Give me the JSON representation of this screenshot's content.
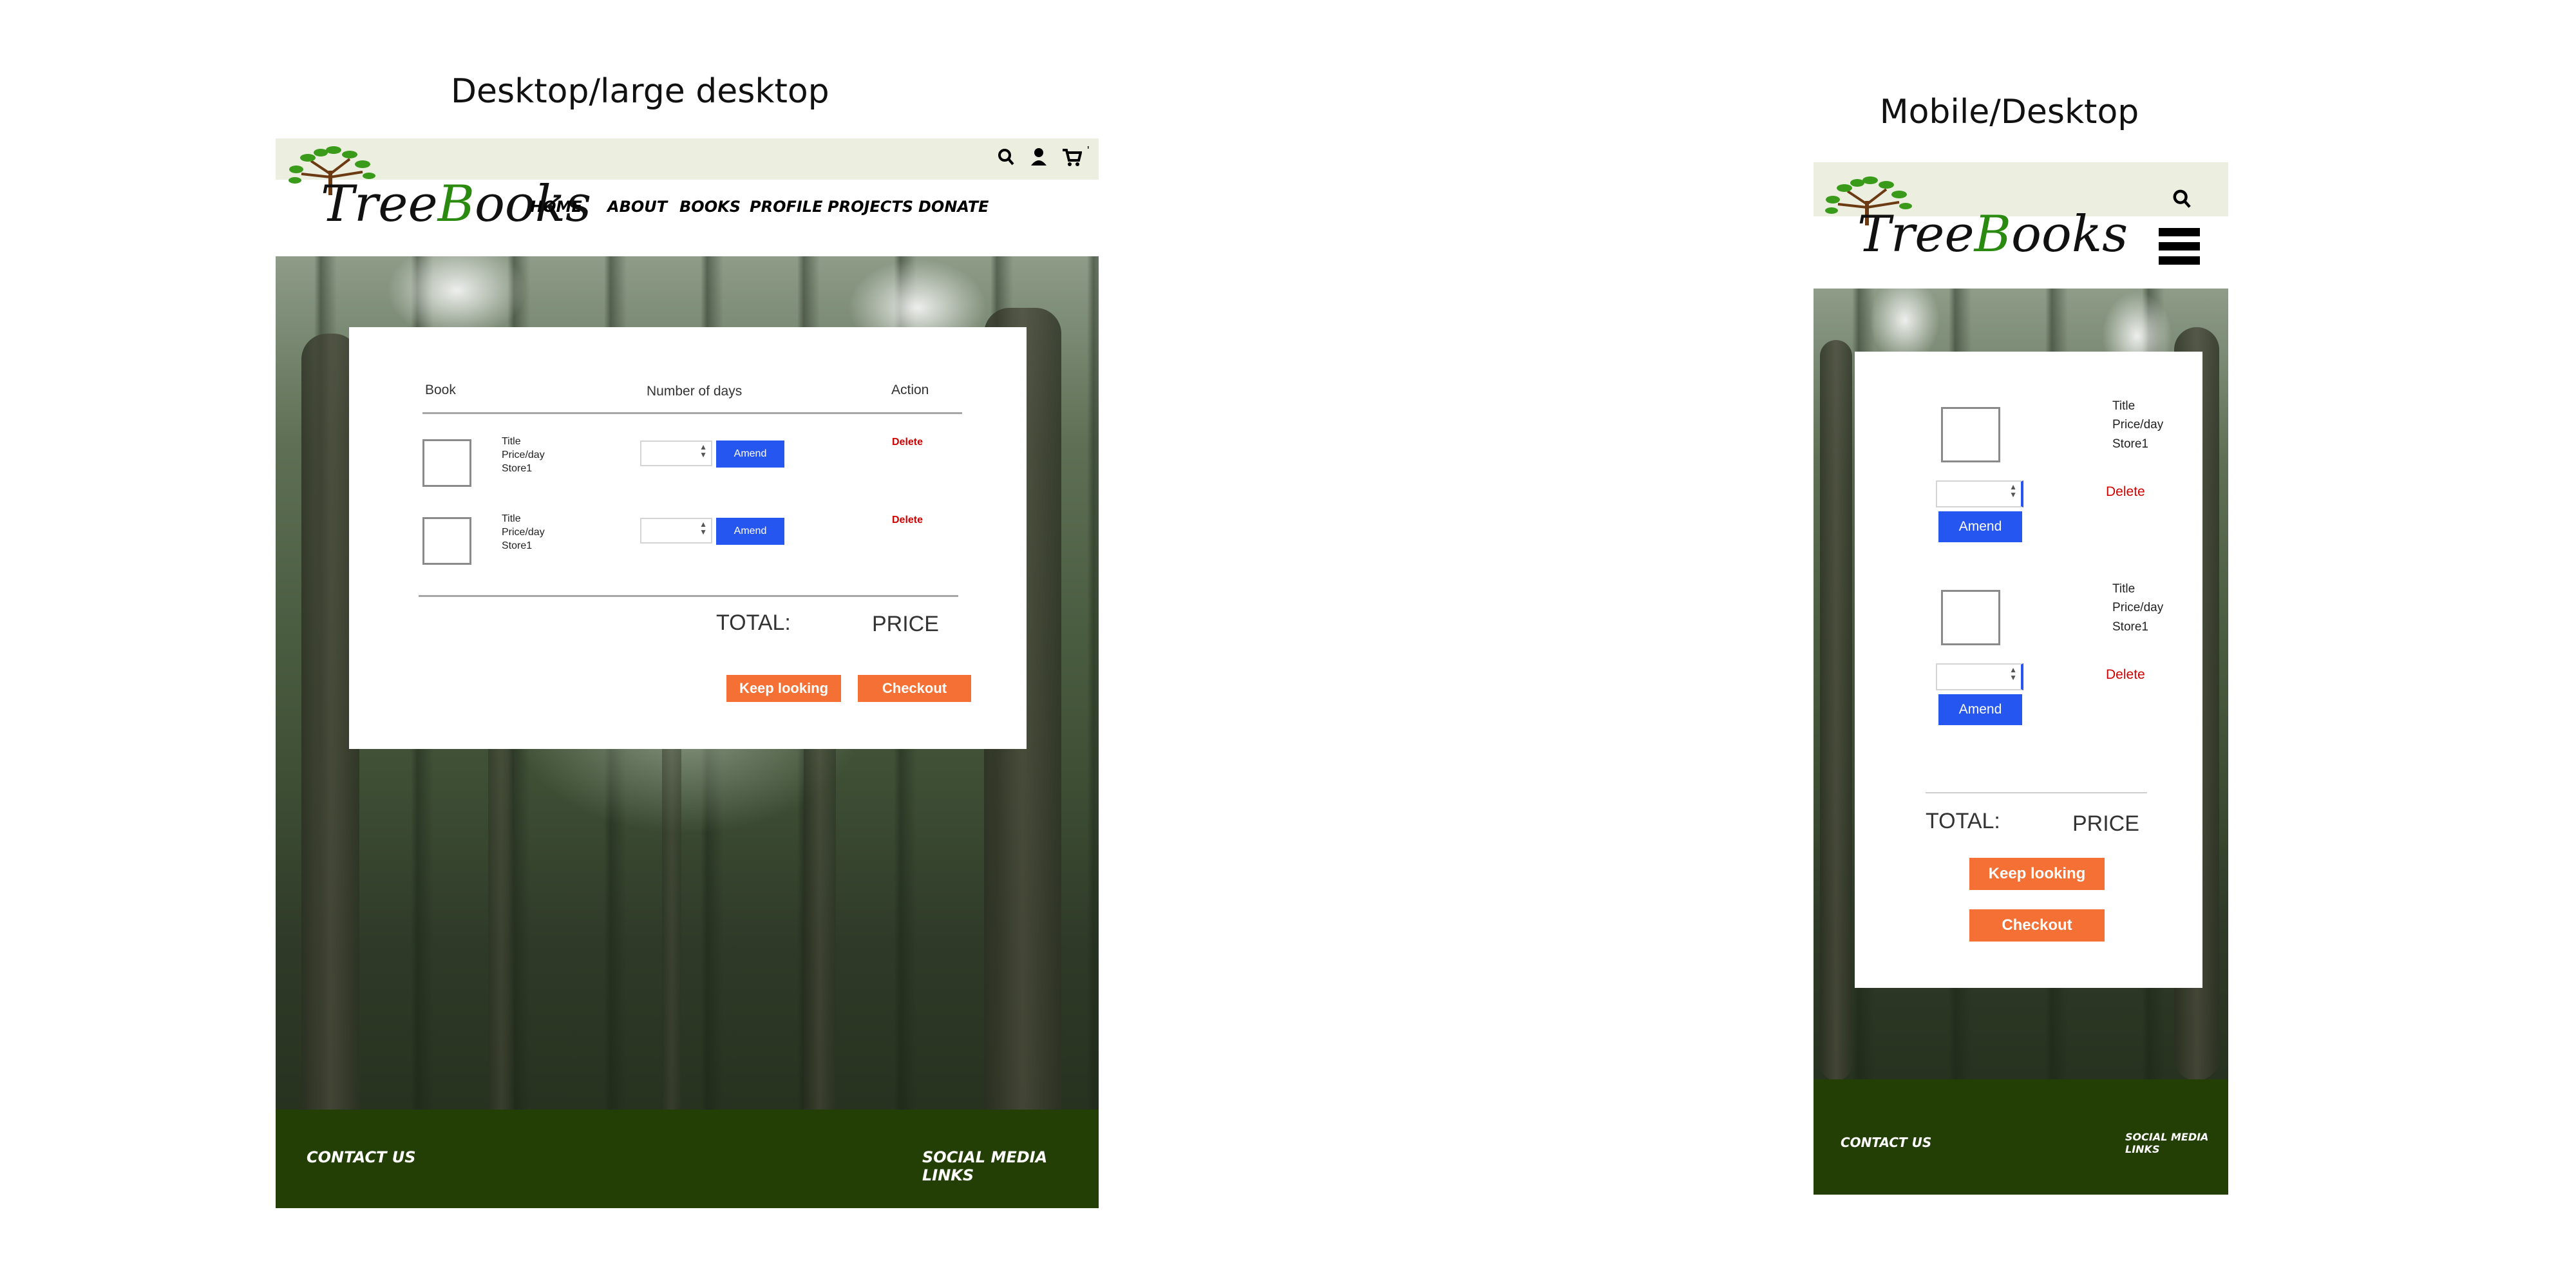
{
  "desktop": {
    "heading": "Desktop/large desktop",
    "logo": {
      "prefix": "Tree",
      "b": "B",
      "suffix": "ooks"
    },
    "nav": [
      "HOME",
      "ABOUT",
      "BOOKS",
      "PROFILE",
      "PROJECTS",
      "DONATE"
    ],
    "table": {
      "headers": {
        "book": "Book",
        "days": "Number of days",
        "action": "Action"
      },
      "rows": [
        {
          "title": "Title",
          "price": "Price/day",
          "store": "Store1",
          "amend": "Amend",
          "delete": "Delete"
        },
        {
          "title": "Title",
          "price": "Price/day",
          "store": "Store1",
          "amend": "Amend",
          "delete": "Delete"
        }
      ]
    },
    "total_label": "TOTAL:",
    "price_label": "PRICE",
    "keep_looking": "Keep looking",
    "checkout": "Checkout",
    "footer": {
      "contact": "CONTACT US",
      "social": "SOCIAL MEDIA LINKS"
    }
  },
  "mobile": {
    "heading": "Mobile/Desktop",
    "logo": {
      "prefix": "Tree",
      "b": "B",
      "suffix": "ooks"
    },
    "rows": [
      {
        "title": "Title",
        "price": "Price/day",
        "store": "Store1",
        "amend": "Amend",
        "delete": "Delete"
      },
      {
        "title": "Title",
        "price": "Price/day",
        "store": "Store1",
        "amend": "Amend",
        "delete": "Delete"
      }
    ],
    "total_label": "TOTAL:",
    "price_label": "PRICE",
    "keep_looking": "Keep looking",
    "checkout": "Checkout",
    "footer": {
      "contact": "CONTACT US",
      "social": "SOCIAL MEDIA LINKS"
    }
  },
  "colors": {
    "topbar": "#eceee0",
    "footer": "#233f06",
    "amend_button": "#2656f0",
    "orange_button": "#f47034",
    "delete_text": "#d00000"
  },
  "icons": [
    "search-icon",
    "user-icon",
    "cart-icon",
    "hamburger-menu-icon"
  ]
}
